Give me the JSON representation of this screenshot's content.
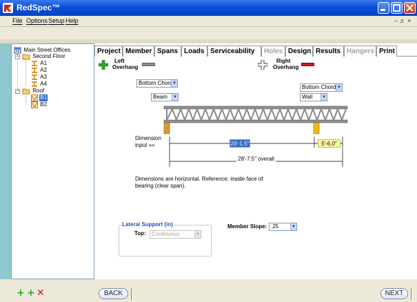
{
  "app": {
    "title": "RedSpec™"
  },
  "menu": {
    "items": [
      "File",
      "Options",
      "Setup",
      "Help"
    ],
    "mdi_controls": "– ♬ ×"
  },
  "tree": {
    "root": "Main Street Offices",
    "floors": [
      {
        "name": "Second Floor",
        "members": [
          "A1",
          "A2",
          "A3",
          "A4"
        ]
      },
      {
        "name": "Roof",
        "members": [
          "B1",
          "B2"
        ]
      }
    ],
    "selected": "B1"
  },
  "tabs": [
    {
      "label": "Project",
      "state": "normal"
    },
    {
      "label": "Member",
      "state": "normal"
    },
    {
      "label": "Spans",
      "state": "active"
    },
    {
      "label": "Loads",
      "state": "normal"
    },
    {
      "label": "Serviceability",
      "state": "normal"
    },
    {
      "label": "Holes",
      "state": "disabled"
    },
    {
      "label": "Design",
      "state": "normal"
    },
    {
      "label": "Results",
      "state": "normal"
    },
    {
      "label": "Hangers",
      "state": "disabled"
    },
    {
      "label": "Print",
      "state": "normal"
    }
  ],
  "spans": {
    "left_overhang": {
      "line1": "Left",
      "line2": "Overhang"
    },
    "right_overhang": {
      "line1": "Right",
      "line2": "Overhang"
    },
    "left_bearing_chord": "Bottom Chord",
    "left_bearing_type": "Beam",
    "right_bearing_chord": "Bottom Chord",
    "right_bearing_type": "Wall",
    "dimension_label": {
      "line1": "Dimension",
      "line2": "input »»"
    },
    "clear_span": "23'-1.5\"",
    "right_span": "5'-6.0\"",
    "overall": "28'-7.5\" overall",
    "note": {
      "line1": "Dimensions are horizontal. Reference: inside face of",
      "line2": "bearing (clear span)."
    }
  },
  "lateral_support": {
    "title": "Lateral Support (in)",
    "top_label": "Top:",
    "top_value": "Continuous"
  },
  "member_slope": {
    "label": "Member Slope:",
    "value": ".25"
  },
  "nav": {
    "back": "BACK",
    "next": "NEXT"
  },
  "colors": {
    "title_blue": "#0a4fd8",
    "add_green": "#2aa52a",
    "remove_red": "#d01818",
    "bearing_orange": "#d99a2c",
    "right_bearing_yellow": "#f2b810",
    "truss_gray": "#8a8a8a",
    "group_title_blue": "#1f4fb3"
  }
}
